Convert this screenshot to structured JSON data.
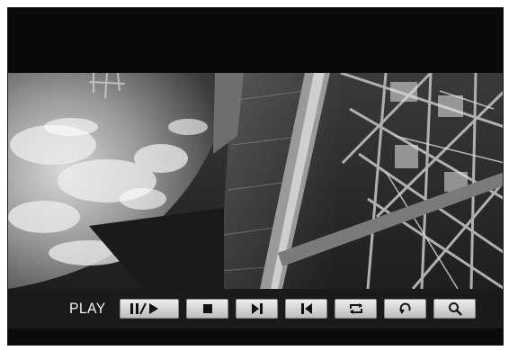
{
  "player": {
    "mode_label": "PLAY",
    "video": {
      "description_icon": "earth-orbit-station-frame"
    },
    "controls": [
      {
        "id": "play-pause",
        "icon": "pause-play-icon",
        "label": ""
      },
      {
        "id": "stop",
        "icon": "stop-icon",
        "label": ""
      },
      {
        "id": "next",
        "icon": "next-frame-icon",
        "label": ""
      },
      {
        "id": "previous",
        "icon": "previous-frame-icon",
        "label": ""
      },
      {
        "id": "repeat",
        "icon": "repeat-icon",
        "label": ""
      },
      {
        "id": "rotate",
        "icon": "rotate-icon",
        "label": ""
      },
      {
        "id": "zoom",
        "icon": "zoom-icon",
        "label": ""
      }
    ]
  },
  "colors": {
    "background": "#0b0b0b",
    "button_face": "#d6d6d6",
    "icon": "#111111",
    "label": "#f2f2f2"
  }
}
